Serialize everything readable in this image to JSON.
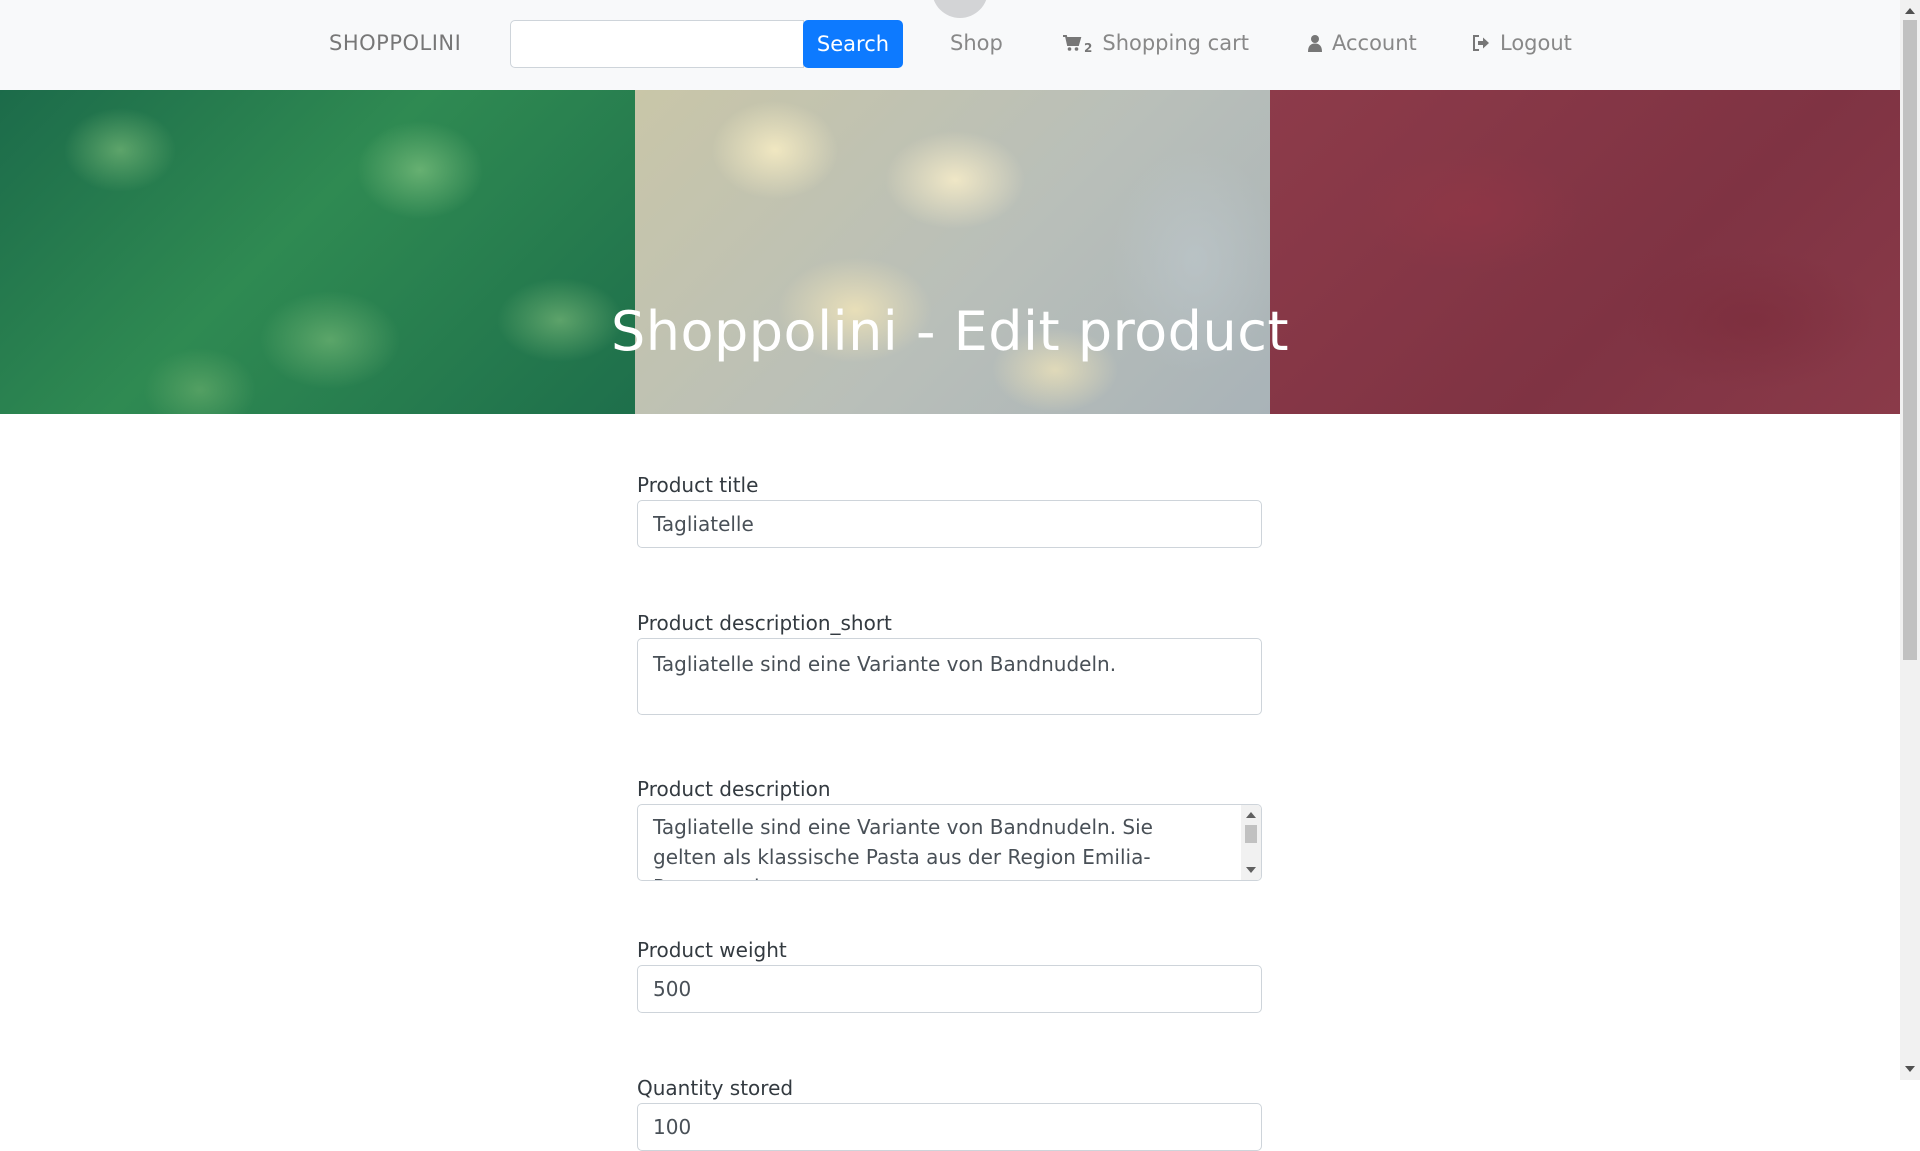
{
  "navbar": {
    "brand": "SHOPPOLINI",
    "search": {
      "value": "",
      "placeholder": "",
      "button_label": "Search"
    },
    "links": {
      "shop": "Shop",
      "cart_count": "2",
      "cart": "Shopping cart",
      "account": "Account",
      "logout": "Logout"
    },
    "icons": {
      "cart": "shopping-cart-icon",
      "account": "user-icon",
      "logout": "sign-out-icon"
    }
  },
  "hero": {
    "title": "Shoppolini - Edit product",
    "colors": {
      "green": "#1f7a4d",
      "white": "#c9c6a8",
      "red": "#8d3b4a"
    }
  },
  "form": {
    "fields": [
      {
        "label": "Product title",
        "value": "Tagliatelle"
      },
      {
        "label": "Product description_short",
        "value": "Tagliatelle sind eine Variante von Bandnudeln."
      },
      {
        "label": "Product description",
        "value": "Tagliatelle sind eine Variante von Bandnudeln. Sie gelten als klassische Pasta aus der Region Emilia-Romagna in"
      },
      {
        "label": "Product weight",
        "value": "500"
      },
      {
        "label": "Quantity stored",
        "value": "100"
      }
    ]
  },
  "colors": {
    "accent": "#0d7aff",
    "navbar_bg": "#f8f9fa",
    "text": "#495057"
  }
}
